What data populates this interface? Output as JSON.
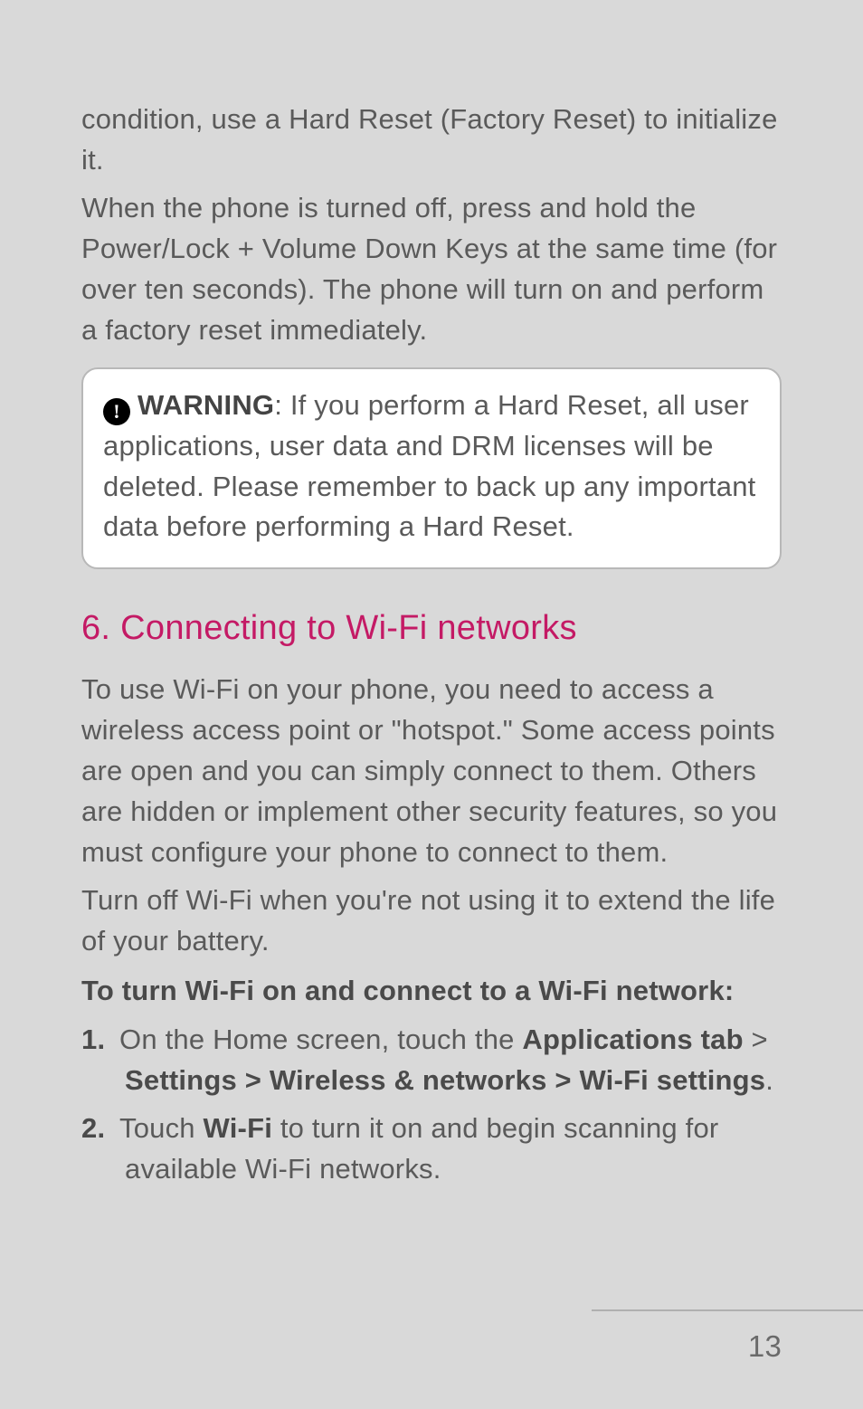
{
  "intro": {
    "p1": "condition, use a Hard Reset (Factory Reset) to initialize it.",
    "p2": "When the phone is turned off, press and hold the Power/Lock + Volume Down Keys at the same time (for over ten seconds). The phone will turn on and perform a factory reset immediately."
  },
  "warning": {
    "icon_glyph": "!",
    "label": "WARNING",
    "text": ": If you perform a Hard Reset, all user applications, user data and DRM licenses will be deleted. Please remember to back up any important data before performing a Hard Reset."
  },
  "section": {
    "heading": "6. Connecting to Wi-Fi networks",
    "p1": "To use Wi-Fi on your phone, you need to access a wireless access point or \"hotspot.\" Some access points are open and you can simply connect to them. Others are hidden or implement other security features, so you must configure your phone to connect to them.",
    "p2": "Turn off Wi-Fi when you're not using it to extend the life of your battery.",
    "subhead": "To turn Wi-Fi on and connect to a Wi-Fi network:",
    "steps": [
      {
        "num": "1.",
        "prefix": "On the Home screen, touch the ",
        "bold1": "Applications tab",
        "mid1": " > ",
        "bold2": "Settings > Wireless & networks > Wi-Fi settings",
        "suffix": "."
      },
      {
        "num": "2.",
        "prefix": "Touch ",
        "bold1": "Wi-Fi",
        "mid1": " to turn it on and begin scanning for available Wi-Fi networks.",
        "bold2": "",
        "suffix": ""
      }
    ]
  },
  "page_number": "13"
}
